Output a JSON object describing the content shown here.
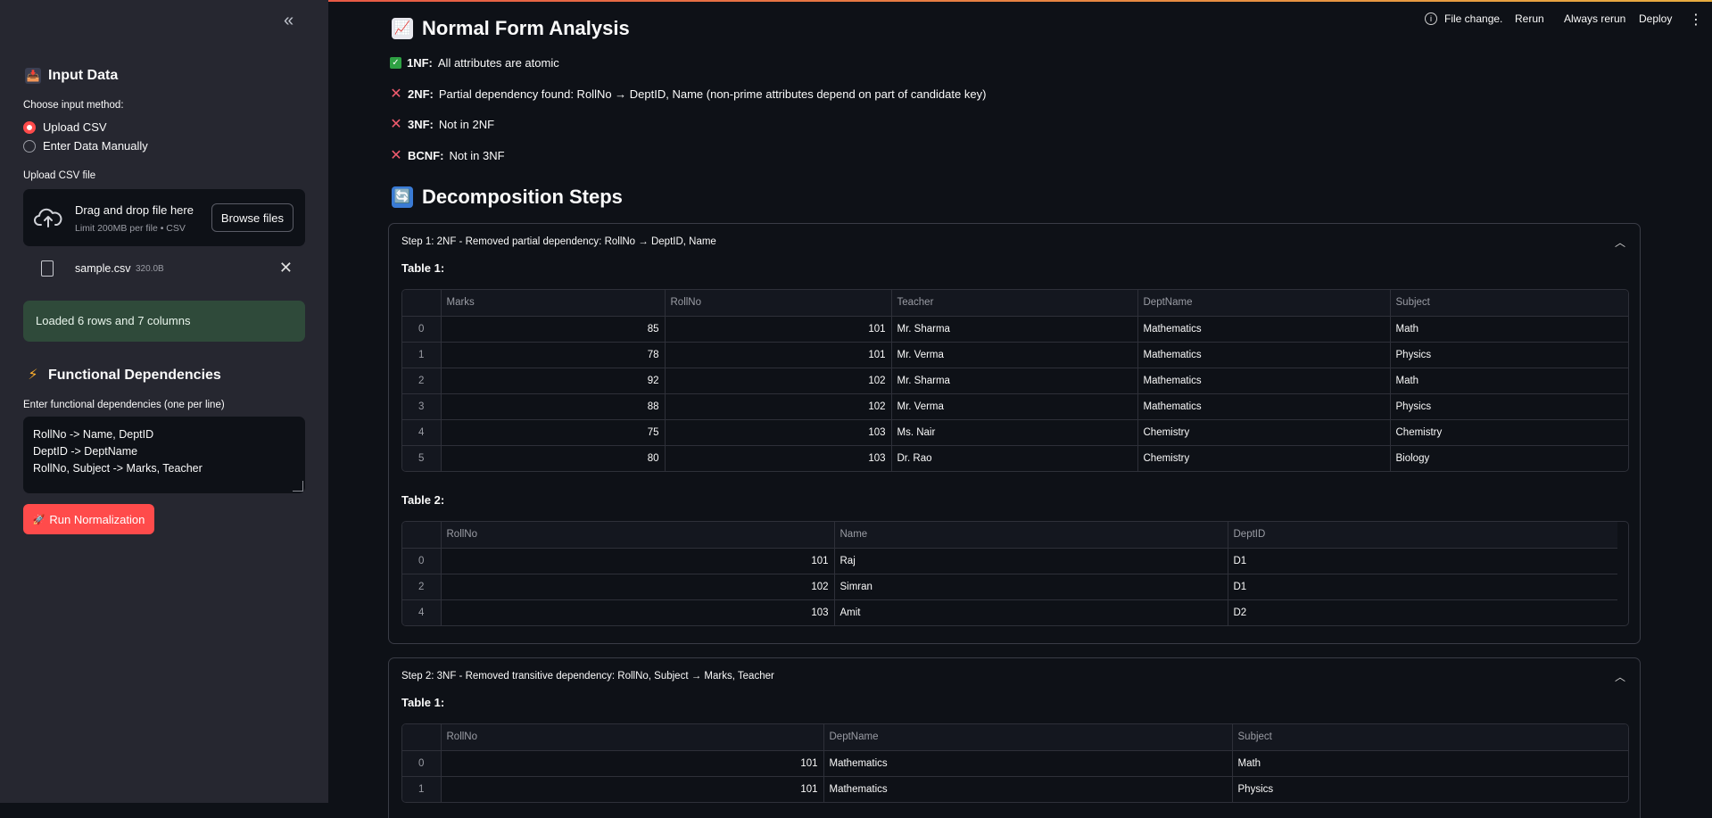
{
  "sidebar": {
    "input_title": "Input Data",
    "choose_label": "Choose input method:",
    "options": [
      "Upload CSV",
      "Enter Data Manually"
    ],
    "upload_label": "Upload CSV file",
    "drop_title": "Drag and drop file here",
    "drop_sub": "Limit 200MB per file • CSV",
    "browse_label": "Browse files",
    "file_name": "sample.csv",
    "file_size": "320.0B",
    "success_msg": "Loaded 6 rows and 7 columns",
    "fd_title": "Functional Dependencies",
    "fd_label": "Enter functional dependencies (one per line)",
    "fd_lines": [
      "RollNo -> Name, DeptID",
      "DeptID -> DeptName",
      "RollNo, Subject -> Marks, Teacher"
    ],
    "run_label": "Run Normalization"
  },
  "header": {
    "file_change": "File change.",
    "rerun": "Rerun",
    "always_rerun": "Always rerun",
    "deploy": "Deploy"
  },
  "analysis": {
    "title": "Normal Form Analysis",
    "nf1_key": "1NF:",
    "nf1_text": "All attributes are atomic",
    "nf2_key": "2NF:",
    "nf2_text": "Partial dependency found: RollNo → DeptID, Name (non-prime attributes depend on part of candidate key)",
    "nf3_key": "3NF:",
    "nf3_text": "Not in 2NF",
    "bcnf_key": "BCNF:",
    "bcnf_text": "Not in 3NF"
  },
  "decomp": {
    "title": "Decomposition Steps",
    "step1": {
      "header": "Step 1: 2NF - Removed partial dependency: RollNo → DeptID, Name",
      "t1_title": "Table 1:",
      "t1_cols": [
        "Marks",
        "RollNo",
        "Teacher",
        "DeptName",
        "Subject"
      ],
      "t1_rows": [
        [
          "0",
          "85",
          "101",
          "Mr. Sharma",
          "Mathematics",
          "Math"
        ],
        [
          "1",
          "78",
          "101",
          "Mr. Verma",
          "Mathematics",
          "Physics"
        ],
        [
          "2",
          "92",
          "102",
          "Mr. Sharma",
          "Mathematics",
          "Math"
        ],
        [
          "3",
          "88",
          "102",
          "Mr. Verma",
          "Mathematics",
          "Physics"
        ],
        [
          "4",
          "75",
          "103",
          "Ms. Nair",
          "Chemistry",
          "Chemistry"
        ],
        [
          "5",
          "80",
          "103",
          "Dr. Rao",
          "Chemistry",
          "Biology"
        ]
      ],
      "t2_title": "Table 2:",
      "t2_cols": [
        "RollNo",
        "Name",
        "DeptID"
      ],
      "t2_rows": [
        [
          "0",
          "101",
          "Raj",
          "D1"
        ],
        [
          "2",
          "102",
          "Simran",
          "D1"
        ],
        [
          "4",
          "103",
          "Amit",
          "D2"
        ]
      ]
    },
    "step2": {
      "header": "Step 2: 3NF - Removed transitive dependency: RollNo, Subject → Marks, Teacher",
      "t1_title": "Table 1:",
      "t1_cols": [
        "RollNo",
        "DeptName",
        "Subject"
      ],
      "t1_rows": [
        [
          "0",
          "101",
          "Mathematics",
          "Math"
        ],
        [
          "1",
          "101",
          "Mathematics",
          "Physics"
        ]
      ]
    }
  }
}
